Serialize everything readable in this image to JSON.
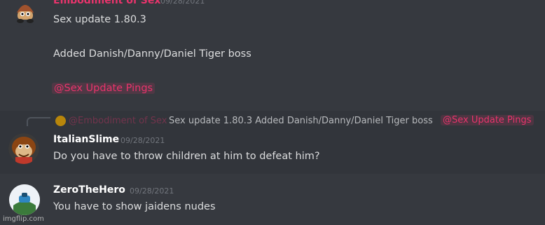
{
  "messages": [
    {
      "author": "Embodiment of Sex",
      "timestamp": "09/28/2021",
      "lines": [
        "Sex update 1.80.3",
        "Added Danish/Danny/Daniel Tiger boss"
      ],
      "mention": "@Sex Update Pings",
      "name_color": "#e9346c"
    },
    {
      "reply": {
        "author": "@Embodiment of Sex",
        "text": "Sex update 1.80.3  Added Danish/Danny/Daniel Tiger boss",
        "mention": "@Sex Update Pings"
      },
      "author": "ItalianSlime",
      "timestamp": "09/28/2021",
      "text": "Do you have to throw children at him to defeat him?",
      "name_color": "#ffffff"
    },
    {
      "author": "ZeroTheHero",
      "timestamp": "09/28/2021",
      "text": "You have to show jaidens nudes",
      "name_color": "#ffffff"
    }
  ],
  "watermark": "imgflip.com"
}
